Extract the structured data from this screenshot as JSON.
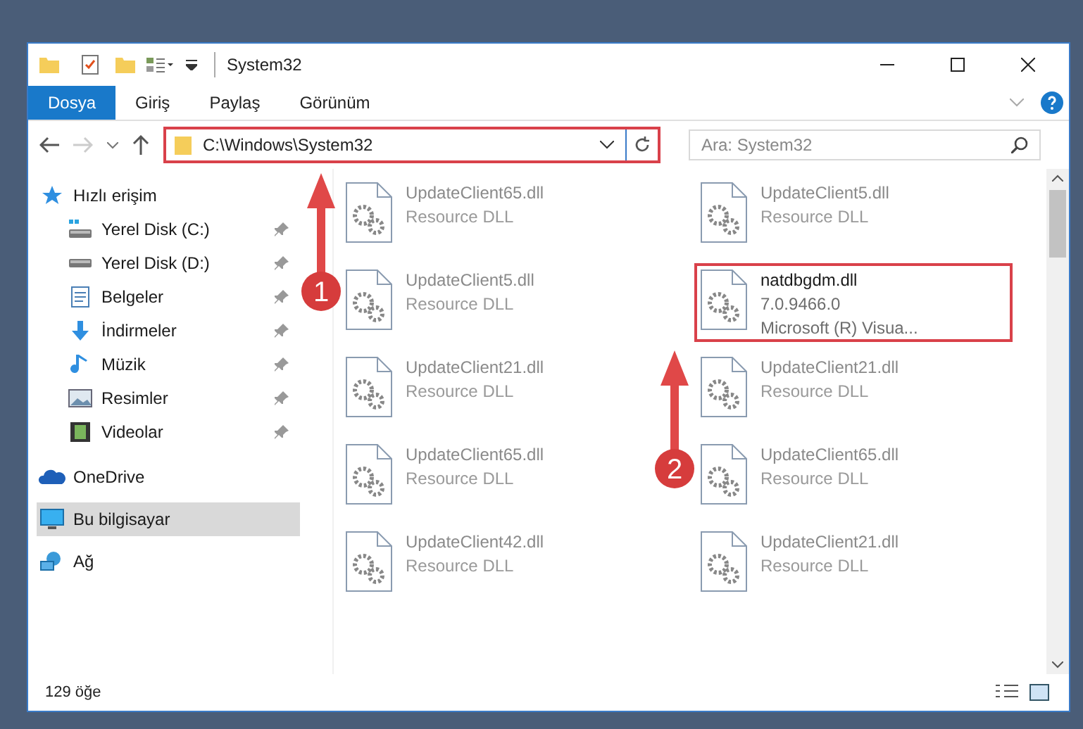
{
  "window": {
    "title": "System32"
  },
  "ribbon_tabs": [
    {
      "label": "Dosya",
      "selected": true
    },
    {
      "label": "Giriş",
      "selected": false
    },
    {
      "label": "Paylaş",
      "selected": false
    },
    {
      "label": "Görünüm",
      "selected": false
    }
  ],
  "address_bar": {
    "value": "C:\\Windows\\System32",
    "highlighted": true
  },
  "search": {
    "placeholder": "Ara: System32"
  },
  "sidebar": {
    "items": [
      {
        "label": "Hızlı erişim",
        "selected": false,
        "children": [
          {
            "label": "Yerel Disk (C:)",
            "pinned": true,
            "selected": false
          },
          {
            "label": "Yerel Disk (D:)",
            "pinned": true,
            "selected": false
          },
          {
            "label": "Belgeler",
            "pinned": true,
            "selected": false
          },
          {
            "label": "İndirmeler",
            "pinned": true,
            "selected": false
          },
          {
            "label": "Müzik",
            "pinned": true,
            "selected": false
          },
          {
            "label": "Resimler",
            "pinned": true,
            "selected": false
          },
          {
            "label": "Videolar",
            "pinned": true,
            "selected": false
          }
        ]
      },
      {
        "label": "OneDrive",
        "selected": false
      },
      {
        "label": "Bu bilgisayar",
        "selected": true
      },
      {
        "label": "Ağ",
        "selected": false
      }
    ]
  },
  "files": [
    {
      "name": "UpdateClient65.dll",
      "line_2": "Resource DLL",
      "blurred": true,
      "highlighted": false
    },
    {
      "name": "UpdateClient5.dll",
      "line_2": "Resource DLL",
      "blurred": true,
      "highlighted": false
    },
    {
      "name": "UpdateClient5.dll",
      "line_2": "Resource DLL",
      "blurred": true,
      "highlighted": false
    },
    {
      "name": "natdbgdm.dll",
      "line_2": "7.0.9466.0",
      "line_3": "Microsoft (R) Visua...",
      "blurred": false,
      "highlighted": true
    },
    {
      "name": "UpdateClient21.dll",
      "line_2": "Resource DLL",
      "blurred": true,
      "highlighted": false
    },
    {
      "name": "UpdateClient21.dll",
      "line_2": "Resource DLL",
      "blurred": true,
      "highlighted": false
    },
    {
      "name": "UpdateClient65.dll",
      "line_2": "Resource DLL",
      "blurred": true,
      "highlighted": false
    },
    {
      "name": "UpdateClient65.dll",
      "line_2": "Resource DLL",
      "blurred": true,
      "highlighted": false
    },
    {
      "name": "UpdateClient42.dll",
      "line_2": "Resource DLL",
      "blurred": true,
      "highlighted": false
    },
    {
      "name": "UpdateClient21.dll",
      "line_2": "Resource DLL",
      "blurred": true,
      "highlighted": false
    }
  ],
  "annotations": [
    {
      "label": "1"
    },
    {
      "label": "2"
    }
  ],
  "status_bar": {
    "count": "129 öğe"
  }
}
